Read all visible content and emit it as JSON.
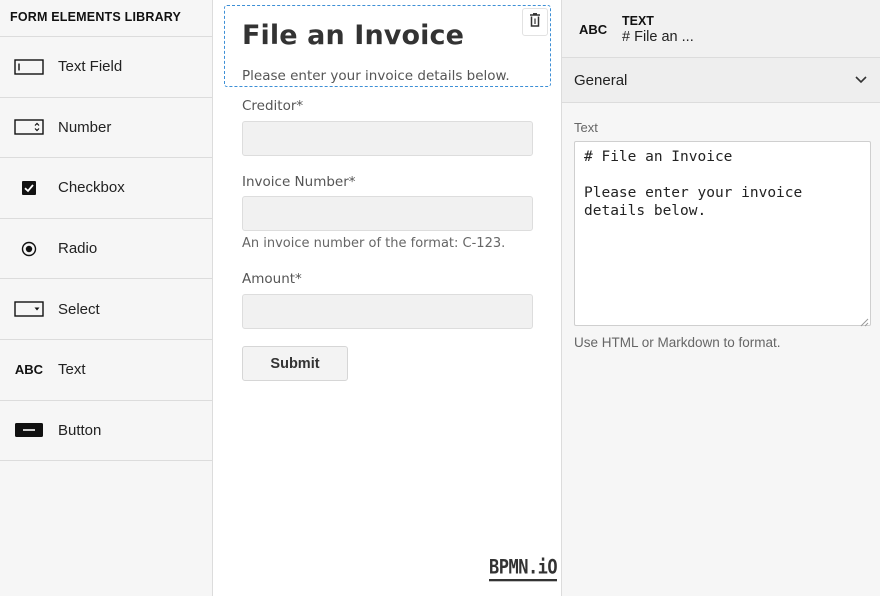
{
  "palette": {
    "header": "FORM ELEMENTS LIBRARY",
    "items": [
      {
        "label": "Text Field",
        "icon": "textfield-icon"
      },
      {
        "label": "Number",
        "icon": "number-icon"
      },
      {
        "label": "Checkbox",
        "icon": "checkbox-icon"
      },
      {
        "label": "Radio",
        "icon": "radio-icon"
      },
      {
        "label": "Select",
        "icon": "select-icon"
      },
      {
        "label": "Text",
        "icon": "text-icon",
        "icon_text": "ABC"
      },
      {
        "label": "Button",
        "icon": "button-icon"
      }
    ]
  },
  "canvas": {
    "heading": "File an Invoice",
    "intro": "Please enter your invoice details below.",
    "fields": [
      {
        "label": "Creditor*",
        "value": ""
      },
      {
        "label": "Invoice Number*",
        "value": "",
        "description": "An invoice number of the format: C-123."
      },
      {
        "label": "Amount*",
        "value": ""
      }
    ],
    "submit_label": "Submit",
    "brand": "BPMN.iO"
  },
  "properties": {
    "type_icon": "ABC",
    "type_name": "TEXT",
    "type_value": "# File an ...",
    "group_title": "General",
    "text_label": "Text",
    "text_value": "# File an Invoice\n\nPlease enter your invoice\ndetails below.",
    "hint": "Use HTML or Markdown to format."
  }
}
